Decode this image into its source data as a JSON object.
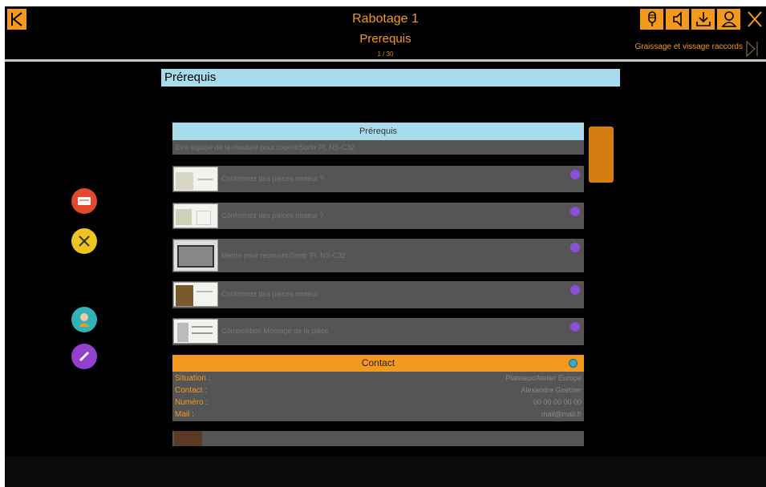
{
  "header": {
    "title": "Rabotage 1",
    "subtitle": "Prerequis",
    "page_count": "1 / 30",
    "next_label": "Graissage et vissage raccords"
  },
  "section": {
    "title": "Prérequis"
  },
  "prereq_block": {
    "heading": "Prérequis",
    "subtitle": "Etre équipé de la moulure pour rouvrir/Sortir Pl. NS-C32"
  },
  "items": [
    {
      "label": "Conformez des pièces moteur ?"
    },
    {
      "label": "Conformez des pièces moteur ?"
    },
    {
      "label": "Mettre pour recouvrir/Sortir Pl. NS-C32"
    },
    {
      "label": "Conformez des pièces moteur"
    },
    {
      "label": "Composition Montage de la pièce"
    }
  ],
  "contact": {
    "heading": "Contact",
    "rows": [
      {
        "key": "Situation :",
        "value": "Plateaux/Atelier Europe"
      },
      {
        "key": "Contact :",
        "value": "Alexandre Goetner"
      },
      {
        "key": "Numéro :",
        "value": "00 00 00 00 00"
      },
      {
        "key": "Mail :",
        "value": "mail@mail.fr"
      }
    ]
  },
  "colors": {
    "accent": "#f39a1e",
    "section_blue": "#a8dcec",
    "row_gray": "#555555",
    "badge_purple": "#8b4fd8"
  },
  "icons": {
    "back": "back-arrow-icon",
    "tools": [
      "microphone-icon",
      "speaker-icon",
      "download-icon",
      "user-icon"
    ],
    "close": "close-icon",
    "next": "next-arrow-icon",
    "side": [
      "card-icon",
      "tools-icon",
      "person-icon",
      "pencil-icon"
    ]
  }
}
